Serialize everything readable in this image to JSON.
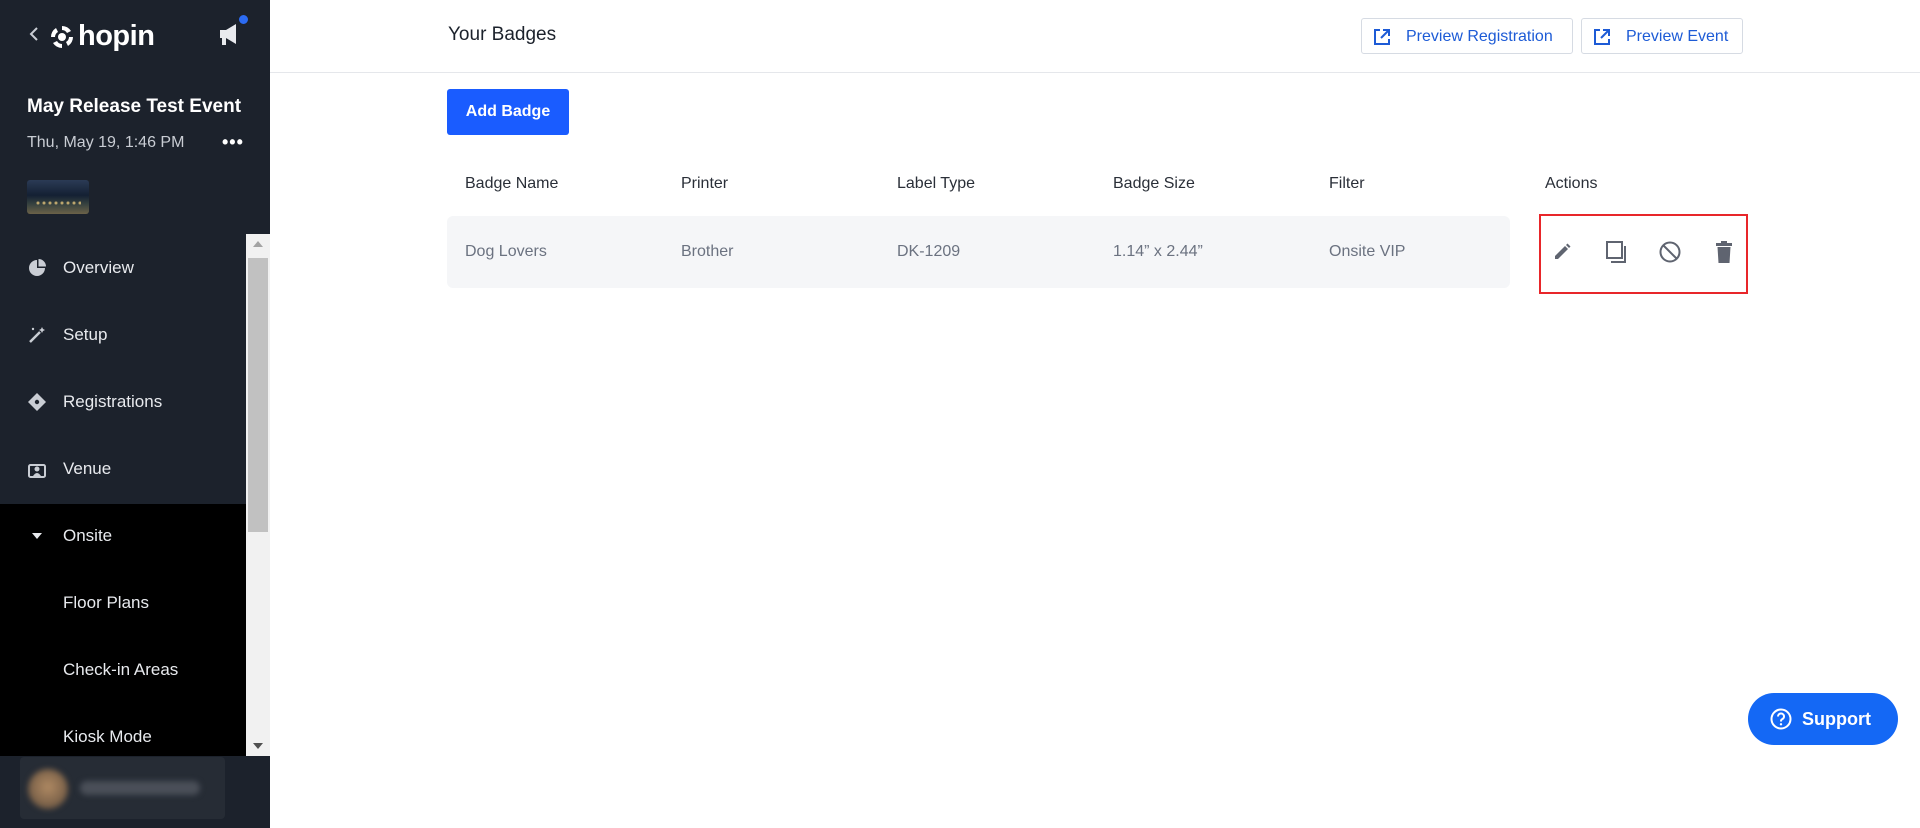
{
  "sidebar": {
    "logo_text": "hopin",
    "event_title": "May Release Test Event",
    "event_date": "Thu, May 19, 1:46 PM",
    "more_label": "•••",
    "nav": [
      {
        "label": "Overview",
        "icon": "pie-chart-icon"
      },
      {
        "label": "Setup",
        "icon": "magic-wand-icon"
      },
      {
        "label": "Registrations",
        "icon": "ticket-icon"
      },
      {
        "label": "Venue",
        "icon": "venue-icon"
      },
      {
        "label": "Onsite",
        "icon": "caret-down-icon",
        "expanded": true
      }
    ],
    "onsite_items": [
      {
        "label": "Floor Plans"
      },
      {
        "label": "Check-in Areas"
      },
      {
        "label": "Kiosk Mode"
      }
    ]
  },
  "header": {
    "title": "Your Badges",
    "preview_registration": "Preview Registration",
    "preview_event": "Preview Event"
  },
  "toolbar": {
    "add_badge": "Add Badge"
  },
  "table": {
    "columns": [
      "Badge Name",
      "Printer",
      "Label Type",
      "Badge Size",
      "Filter",
      "Actions"
    ],
    "rows": [
      {
        "badge_name": "Dog Lovers",
        "printer": "Brother",
        "label_type": "DK-1209",
        "badge_size": "1.14” x 2.44”",
        "filter": "Onsite VIP"
      }
    ],
    "actions": [
      "edit-icon",
      "duplicate-icon",
      "disable-icon",
      "delete-icon"
    ]
  },
  "support": {
    "label": "Support"
  },
  "colors": {
    "sidebar_bg": "#1c222c",
    "accent": "#1a5cff",
    "link": "#1d5bd6",
    "highlight": "#e8262a"
  }
}
